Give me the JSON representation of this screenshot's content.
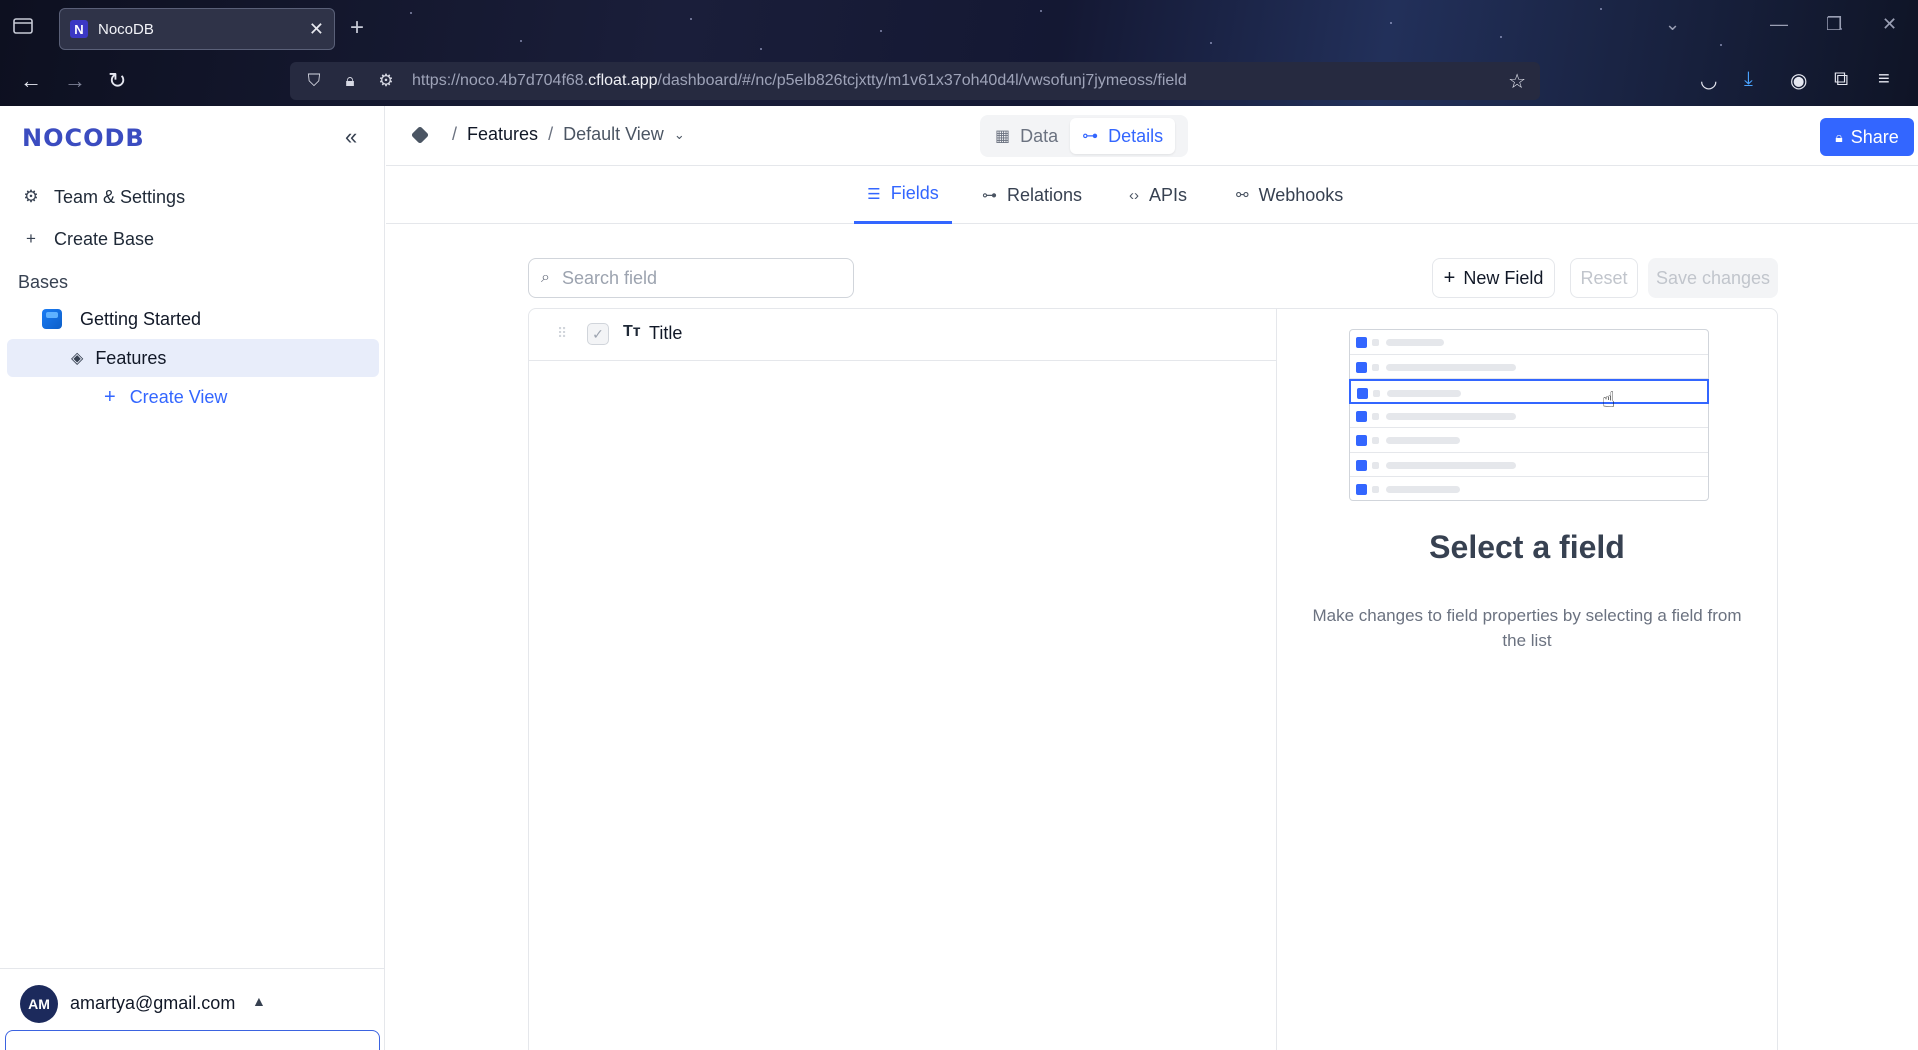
{
  "browser": {
    "tab_title": "NocoDB",
    "favicon_letter": "N",
    "url_prefix": "https://noco.4b7d704f68.",
    "url_domain": "cfloat.app",
    "url_suffix": "/dashboard/#/nc/p5elb826tcjxtty/m1v61x37oh40d4l/vwsofunj7jymeoss/field"
  },
  "sidebar": {
    "logo": "NOCODB",
    "items": [
      {
        "label": "Team & Settings",
        "icon": "gear-icon"
      },
      {
        "label": "Create Base",
        "icon": "plus-icon"
      }
    ],
    "bases_label": "Bases",
    "base": {
      "label": "Getting Started",
      "icon": "base-cube-icon"
    },
    "table": {
      "label": "Features",
      "icon": "table-icon"
    },
    "create_view_label": "Create View",
    "user": {
      "initials": "AM",
      "email": "amartya@gmail.com"
    }
  },
  "topbar": {
    "breadcrumb": {
      "sep": "/",
      "table": "Features",
      "view": "Default View"
    },
    "segments": [
      {
        "label": "Data",
        "icon": "grid-icon",
        "active": false
      },
      {
        "label": "Details",
        "icon": "details-icon",
        "active": true
      }
    ],
    "share_label": "Share"
  },
  "subtabs": [
    {
      "label": "Fields",
      "icon": "list-icon",
      "active": true
    },
    {
      "label": "Relations",
      "icon": "relations-icon",
      "active": false
    },
    {
      "label": "APIs",
      "icon": "code-icon",
      "active": false
    },
    {
      "label": "Webhooks",
      "icon": "webhook-icon",
      "active": false
    }
  ],
  "toolbar": {
    "search_placeholder": "Search field",
    "new_field_label": "New Field",
    "reset_label": "Reset",
    "save_label": "Save changes"
  },
  "fields": [
    {
      "type_icon": "Tт",
      "name": "Title",
      "checked": true
    }
  ],
  "detail": {
    "title": "Select a field",
    "description": "Make changes to field properties by selecting a field from the list"
  },
  "colors": {
    "accent": "#3366ff",
    "logo": "#3b4cc0"
  }
}
